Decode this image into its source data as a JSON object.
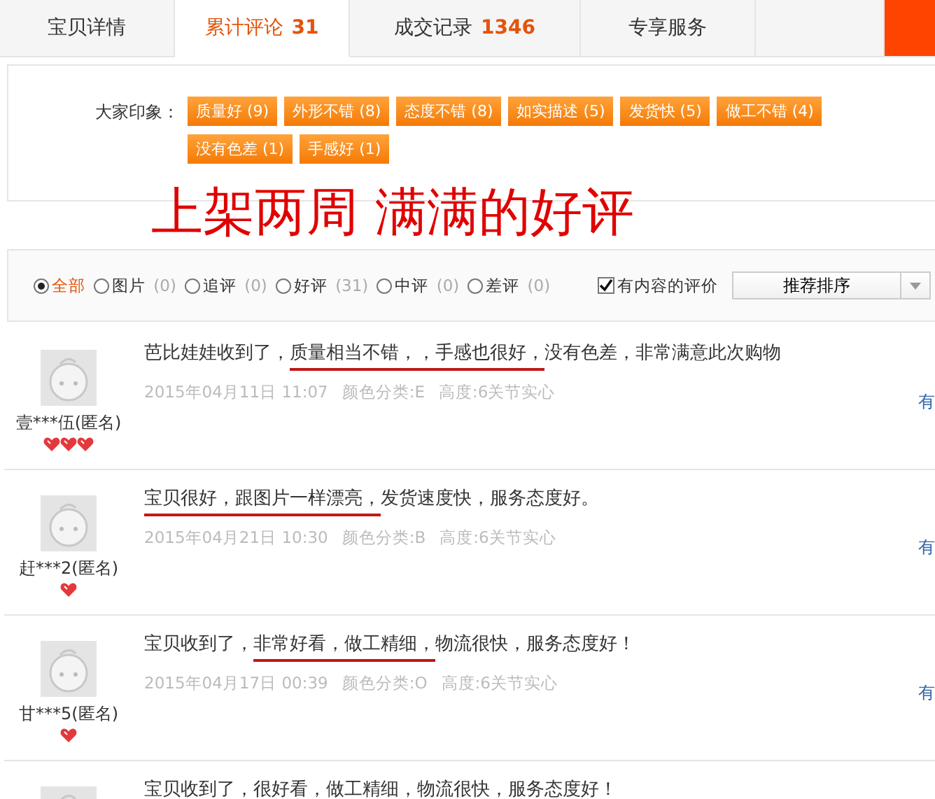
{
  "tabs": [
    {
      "label": "宝贝详情",
      "selected": false
    },
    {
      "label": "累计评论",
      "count": "31",
      "selected": true
    },
    {
      "label": "成交记录",
      "count": "1346",
      "selected": false
    },
    {
      "label": "专享服务",
      "selected": false
    }
  ],
  "impressions": {
    "label": "大家印象：",
    "tags": [
      "质量好 (9)",
      "外形不错 (8)",
      "态度不错 (8)",
      "如实描述 (5)",
      "发货快 (5)",
      "做工不错 (4)",
      "没有色差 (1)",
      "手感好 (1)"
    ]
  },
  "annotation": "上架两周 满满的好评",
  "filters": {
    "options": [
      {
        "label": "全部",
        "selected": true
      },
      {
        "label": "图片",
        "count": "(0)",
        "selected": false
      },
      {
        "label": "追评",
        "count": "(0)",
        "selected": false
      },
      {
        "label": "好评",
        "count": "(31)",
        "selected": false
      },
      {
        "label": "中评",
        "count": "(0)",
        "selected": false
      },
      {
        "label": "差评",
        "count": "(0)",
        "selected": false
      }
    ],
    "content_only": {
      "label": "有内容的评价",
      "checked": true
    },
    "sort": {
      "value": "推荐排序"
    }
  },
  "reviews": [
    {
      "user": "壹***伍(匿名)",
      "badge": {
        "kind": "three_hearts"
      },
      "text": [
        {
          "t": "芭比娃娃收到了，",
          "underlined": false
        },
        {
          "t": "质量相当不错，，手感也很好，",
          "underlined": true
        },
        {
          "t": "没有色差，非常满意此次购物",
          "underlined": false
        }
      ],
      "date": "2015年04月11日 11:07",
      "variant": "颜色分类:E",
      "height": "高度:6关节实心",
      "link": "有"
    },
    {
      "user": "赶***2(匿名)",
      "badge": {
        "kind": "one_heart"
      },
      "text": [
        {
          "t": "宝贝很好，跟图片一样漂亮，",
          "underlined": true
        },
        {
          "t": "发货速度快，服务态度好。",
          "underlined": false
        }
      ],
      "date": "2015年04月21日 10:30",
      "variant": "颜色分类:B",
      "height": "高度:6关节实心",
      "link": "有"
    },
    {
      "user": "甘***5(匿名)",
      "badge": {
        "kind": "one_heart"
      },
      "text": [
        {
          "t": "宝贝收到了，",
          "underlined": false
        },
        {
          "t": "非常好看，做工精细，",
          "underlined": true
        },
        {
          "t": "物流很快，服务态度好！",
          "underlined": false
        }
      ],
      "date": "2015年04月17日 00:39",
      "variant": "颜色分类:O",
      "height": "高度:6关节实心",
      "link": "有"
    },
    {
      "text": [
        {
          "t": "宝贝收到了，很好看，做工精细，物流很快，服务态度好！"
        }
      ]
    }
  ]
}
